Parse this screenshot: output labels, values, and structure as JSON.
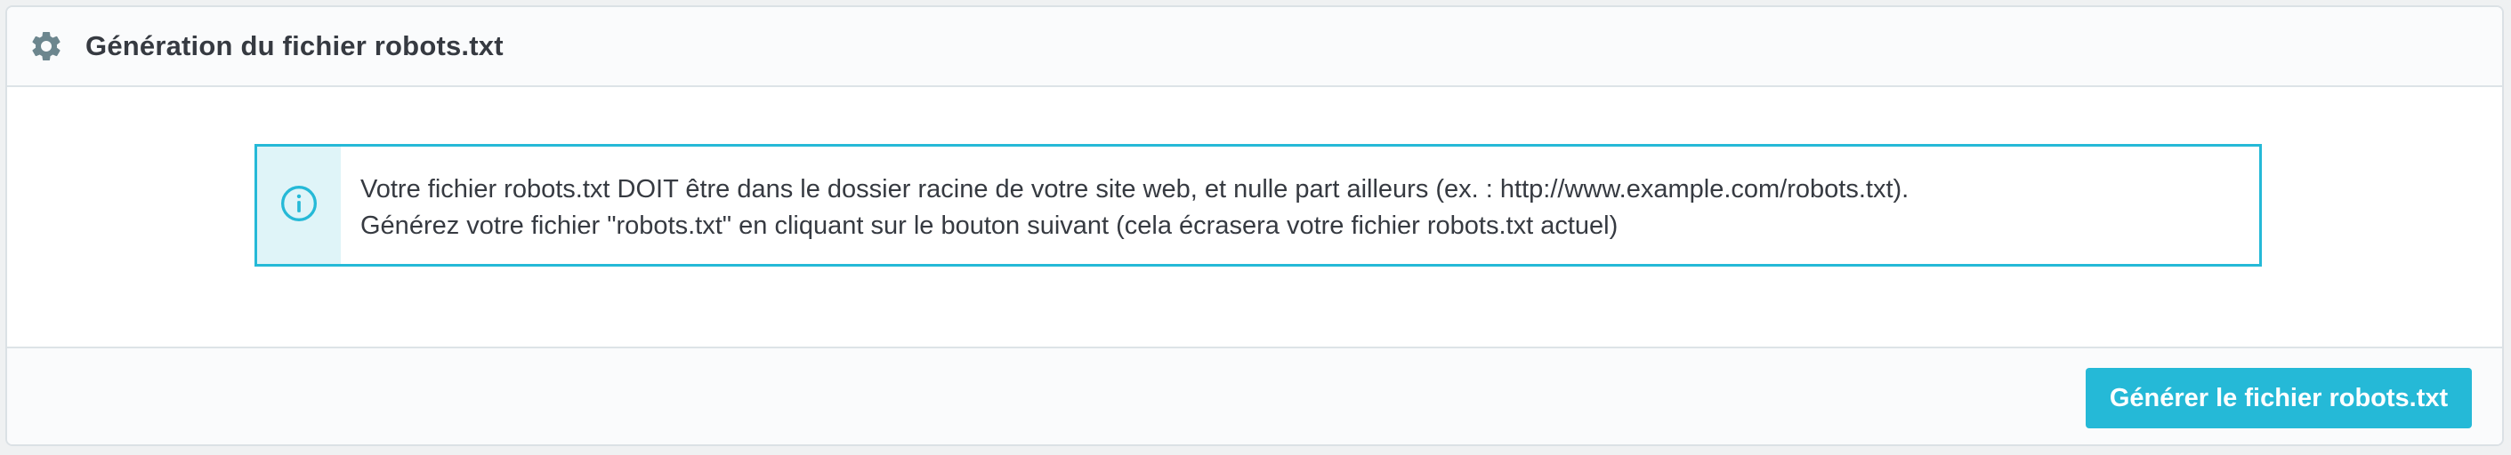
{
  "panel": {
    "icon": "gear-icon",
    "title": "Génération du fichier robots.txt"
  },
  "alert": {
    "icon": "info-circle-icon",
    "line1": "Votre fichier robots.txt DOIT être dans le dossier racine de votre site web, et nulle part ailleurs (ex. : http://www.example.com/robots.txt).",
    "line2": "Générez votre fichier \"robots.txt\" en cliquant sur le bouton suivant (cela écrasera votre fichier robots.txt actuel)"
  },
  "footer": {
    "generate_button_label": "Générer le fichier robots.txt"
  },
  "colors": {
    "accent": "#25b9d7",
    "text": "#363a41",
    "icon_gray": "#6c868e"
  }
}
